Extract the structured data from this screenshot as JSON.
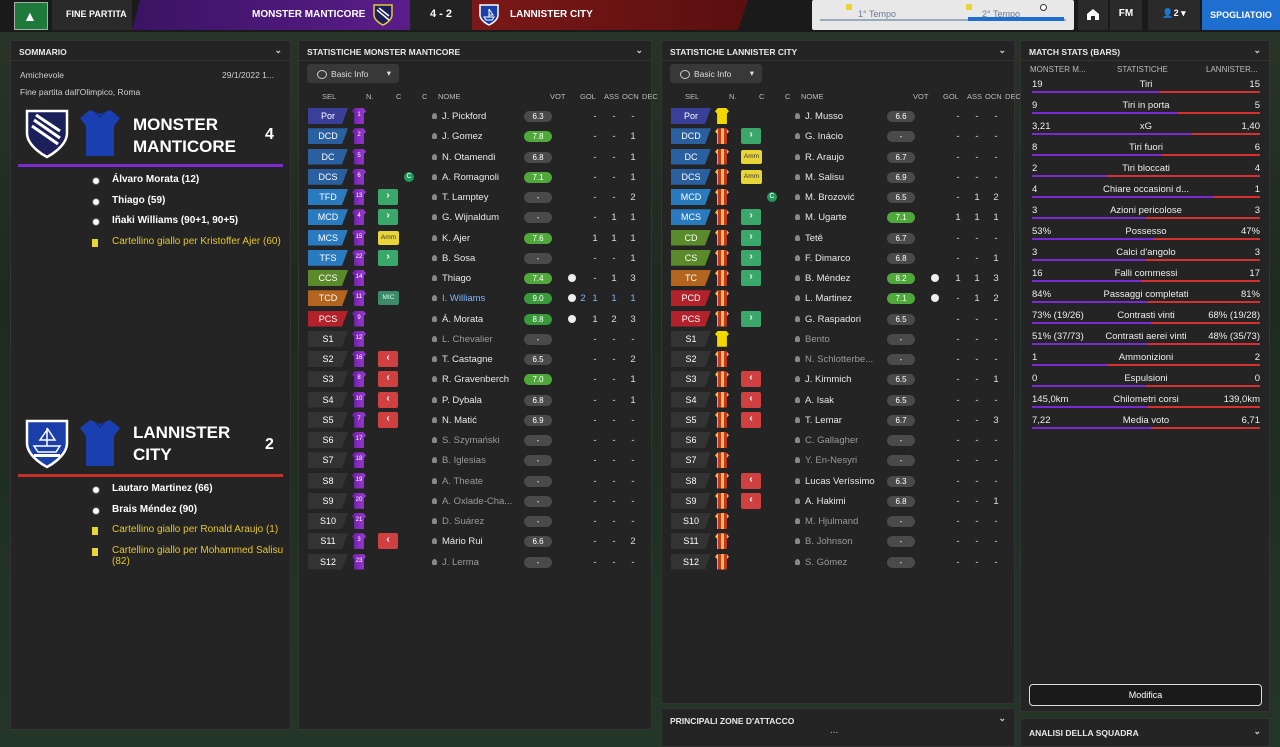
{
  "topbar": {
    "status": "FINE PARTITA",
    "home_team": "MONSTER MANTICORE",
    "score": "4 - 2",
    "away_team": "LANNISTER CITY",
    "first_half": "1° Tempo",
    "second_half": "2° Tempo",
    "fm": "FM",
    "squad_count": "2",
    "dressing_room": "SPOGLIATOIO"
  },
  "summary": {
    "title": "SOMMARIO",
    "competition": "Amichevole",
    "date": "29/1/2022 1...",
    "venue": "Fine partita dall'Olimpico, Roma",
    "home": {
      "name": "MONSTER MANTICORE",
      "score": "4",
      "events": [
        {
          "text": "Álvaro Morata (12)",
          "type": "goal"
        },
        {
          "text": "Thiago (59)",
          "type": "goal"
        },
        {
          "text": "Iñaki Williams (90+1, 90+5)",
          "type": "goal"
        },
        {
          "text": "Cartellino giallo per Kristoffer Ajer (60)",
          "type": "yellow"
        }
      ]
    },
    "away": {
      "name": "LANNISTER CITY",
      "score": "2",
      "events": [
        {
          "text": "Lautaro Martinez (66)",
          "type": "goal"
        },
        {
          "text": "Brais Méndez (90)",
          "type": "goal"
        },
        {
          "text": "Cartellino giallo per Ronald Araujo (1)",
          "type": "yellow"
        },
        {
          "text": "Cartellino giallo per Mohammed Salisu (82)",
          "type": "yellow"
        }
      ]
    }
  },
  "home_stats": {
    "title": "STATISTICHE MONSTER MANTICORE",
    "filter": "Basic Info",
    "columns": [
      "SEL",
      "N.",
      "C",
      "C",
      "NOME",
      "VOT",
      "GOL",
      "ASS",
      "OCN",
      "DEC"
    ],
    "rows": [
      {
        "pos": "Por",
        "num": "1",
        "c": "",
        "name": "J. Pickford",
        "rating": "6.3",
        "gol": "",
        "ass": "-",
        "ocn": "-",
        "dec": "-",
        "rc": "n",
        "pc": "#3a3f9a"
      },
      {
        "pos": "DCD",
        "num": "2",
        "c": "",
        "name": "J. Gomez",
        "rating": "7.8",
        "gol": "",
        "ass": "-",
        "ocn": "-",
        "dec": "1",
        "rc": "g",
        "pc": "#2a5fa0"
      },
      {
        "pos": "DC",
        "num": "5",
        "c": "",
        "name": "N. Otamendi",
        "rating": "6.8",
        "gol": "",
        "ass": "-",
        "ocn": "-",
        "dec": "1",
        "rc": "n",
        "pc": "#2a5fa0"
      },
      {
        "pos": "DCS",
        "num": "6",
        "c": "cap",
        "name": "A. Romagnoli",
        "rating": "7.1",
        "gol": "",
        "ass": "-",
        "ocn": "-",
        "dec": "1",
        "rc": "g",
        "pc": "#2a5fa0"
      },
      {
        "pos": "TFD",
        "num": "13",
        "c": "in",
        "name": "T. Lamptey",
        "rating": "-",
        "gol": "",
        "ass": "-",
        "ocn": "-",
        "dec": "2",
        "rc": "n",
        "pc": "#2a7ac0"
      },
      {
        "pos": "MCD",
        "num": "4",
        "c": "in",
        "name": "G. Wijnaldum",
        "rating": "-",
        "gol": "",
        "ass": "-",
        "ocn": "1",
        "dec": "1",
        "rc": "n",
        "pc": "#2a7ac0"
      },
      {
        "pos": "MCS",
        "num": "15",
        "c": "amm",
        "name": "K. Ajer",
        "rating": "7.6",
        "gol": "",
        "ass": "1",
        "ocn": "1",
        "dec": "1",
        "rc": "g",
        "pc": "#2a7ac0"
      },
      {
        "pos": "TFS",
        "num": "22",
        "c": "in",
        "name": "B. Sosa",
        "rating": "-",
        "gol": "",
        "ass": "-",
        "ocn": "-",
        "dec": "1",
        "rc": "n",
        "pc": "#2a7ac0"
      },
      {
        "pos": "CCS",
        "num": "14",
        "c": "",
        "name": "Thiago",
        "rating": "7.4",
        "gol": "ball",
        "ass": "-",
        "ocn": "1",
        "dec": "3",
        "rc": "g",
        "pc": "#5a8a2a"
      },
      {
        "pos": "TCD",
        "num": "11",
        "c": "mic",
        "name": "I. Williams",
        "rating": "9.0",
        "gol": "ball2",
        "ass": "1",
        "ocn": "1",
        "dec": "1",
        "rc": "e",
        "pc": "#b3641f"
      },
      {
        "pos": "PCS",
        "num": "9",
        "c": "",
        "name": "Á. Morata",
        "rating": "8.8",
        "gol": "ball",
        "ass": "1",
        "ocn": "2",
        "dec": "3",
        "rc": "e",
        "pc": "#b3222a"
      },
      {
        "pos": "S1",
        "num": "12",
        "c": "",
        "name": "L. Chevalier",
        "rating": "-",
        "gol": "",
        "ass": "-",
        "ocn": "-",
        "dec": "-",
        "rc": "n",
        "pc": "",
        "sub": true
      },
      {
        "pos": "S2",
        "num": "16",
        "c": "out",
        "name": "T. Castagne",
        "rating": "6.5",
        "gol": "",
        "ass": "-",
        "ocn": "-",
        "dec": "2",
        "rc": "n",
        "pc": "",
        "sub": true
      },
      {
        "pos": "S3",
        "num": "8",
        "c": "out",
        "name": "R. Gravenberch",
        "rating": "7.0",
        "gol": "",
        "ass": "-",
        "ocn": "-",
        "dec": "1",
        "rc": "g",
        "pc": "",
        "sub": true
      },
      {
        "pos": "S4",
        "num": "10",
        "c": "out",
        "name": "P. Dybala",
        "rating": "6.8",
        "gol": "",
        "ass": "-",
        "ocn": "-",
        "dec": "1",
        "rc": "n",
        "pc": "",
        "sub": true
      },
      {
        "pos": "S5",
        "num": "7",
        "c": "out",
        "name": "N. Matić",
        "rating": "6.9",
        "gol": "",
        "ass": "-",
        "ocn": "-",
        "dec": "-",
        "rc": "n",
        "pc": "",
        "sub": true
      },
      {
        "pos": "S6",
        "num": "17",
        "c": "",
        "name": "S. Szymański",
        "rating": "-",
        "gol": "",
        "ass": "-",
        "ocn": "-",
        "dec": "-",
        "rc": "n",
        "pc": "",
        "sub": true
      },
      {
        "pos": "S7",
        "num": "18",
        "c": "",
        "name": "B. Iglesias",
        "rating": "-",
        "gol": "",
        "ass": "-",
        "ocn": "-",
        "dec": "-",
        "rc": "n",
        "pc": "",
        "sub": true
      },
      {
        "pos": "S8",
        "num": "19",
        "c": "",
        "name": "A. Theate",
        "rating": "-",
        "gol": "",
        "ass": "-",
        "ocn": "-",
        "dec": "-",
        "rc": "n",
        "pc": "",
        "sub": true
      },
      {
        "pos": "S9",
        "num": "20",
        "c": "",
        "name": "A. Oxlade-Cha...",
        "rating": "-",
        "gol": "",
        "ass": "-",
        "ocn": "-",
        "dec": "-",
        "rc": "n",
        "pc": "",
        "sub": true
      },
      {
        "pos": "S10",
        "num": "21",
        "c": "",
        "name": "D. Suárez",
        "rating": "-",
        "gol": "",
        "ass": "-",
        "ocn": "-",
        "dec": "-",
        "rc": "n",
        "pc": "",
        "sub": true
      },
      {
        "pos": "S11",
        "num": "3",
        "c": "out",
        "name": "Mário Rui",
        "rating": "6.6",
        "gol": "",
        "ass": "-",
        "ocn": "-",
        "dec": "2",
        "rc": "n",
        "pc": "",
        "sub": true
      },
      {
        "pos": "S12",
        "num": "23",
        "c": "",
        "name": "J. Lerma",
        "rating": "-",
        "gol": "",
        "ass": "-",
        "ocn": "-",
        "dec": "-",
        "rc": "n",
        "pc": "",
        "sub": true
      }
    ]
  },
  "away_stats": {
    "title": "STATISTICHE LANNISTER CITY",
    "filter": "Basic Info",
    "columns": [
      "SEL",
      "N.",
      "C",
      "C",
      "NOME",
      "VOT",
      "GOL",
      "ASS",
      "OCN",
      "DEC"
    ],
    "rows": [
      {
        "pos": "Por",
        "c": "",
        "name": "J. Musso",
        "rating": "6.6",
        "gol": "",
        "ass": "-",
        "ocn": "-",
        "dec": "-",
        "rc": "n",
        "pc": "#3a3f9a",
        "gk": true
      },
      {
        "pos": "DCD",
        "c": "in",
        "name": "G. Inácio",
        "rating": "-",
        "gol": "",
        "ass": "-",
        "ocn": "-",
        "dec": "-",
        "rc": "n",
        "pc": "#2a5fa0"
      },
      {
        "pos": "DC",
        "c": "amm",
        "name": "R. Araujo",
        "rating": "6.7",
        "gol": "",
        "ass": "-",
        "ocn": "-",
        "dec": "-",
        "rc": "n",
        "pc": "#2a5fa0"
      },
      {
        "pos": "DCS",
        "c": "amm",
        "name": "M. Salisu",
        "rating": "6.9",
        "gol": "",
        "ass": "-",
        "ocn": "-",
        "dec": "-",
        "rc": "n",
        "pc": "#2a5fa0"
      },
      {
        "pos": "MCD",
        "c": "cap",
        "name": "M. Brozović",
        "rating": "6.5",
        "gol": "",
        "ass": "-",
        "ocn": "1",
        "dec": "2",
        "rc": "n",
        "pc": "#2a7ac0"
      },
      {
        "pos": "MCS",
        "c": "in",
        "name": "M. Ugarte",
        "rating": "7.1",
        "gol": "",
        "ass": "1",
        "ocn": "1",
        "dec": "1",
        "rc": "g",
        "pc": "#2a7ac0"
      },
      {
        "pos": "CD",
        "c": "in",
        "name": "Tetê",
        "rating": "6.7",
        "gol": "",
        "ass": "-",
        "ocn": "-",
        "dec": "-",
        "rc": "n",
        "pc": "#5a8a2a"
      },
      {
        "pos": "CS",
        "c": "in",
        "name": "F. Dimarco",
        "rating": "6.8",
        "gol": "",
        "ass": "-",
        "ocn": "-",
        "dec": "1",
        "rc": "n",
        "pc": "#5a8a2a"
      },
      {
        "pos": "TC",
        "c": "in",
        "name": "B. Méndez",
        "rating": "8.2",
        "gol": "ball",
        "ass": "1",
        "ocn": "1",
        "dec": "3",
        "rc": "g",
        "pc": "#b3641f"
      },
      {
        "pos": "PCD",
        "c": "",
        "name": "L. Martinez",
        "rating": "7.1",
        "gol": "ball",
        "ass": "-",
        "ocn": "1",
        "dec": "2",
        "rc": "g",
        "pc": "#b3222a"
      },
      {
        "pos": "PCS",
        "c": "in",
        "name": "G. Raspadori",
        "rating": "6.5",
        "gol": "",
        "ass": "-",
        "ocn": "-",
        "dec": "-",
        "rc": "n",
        "pc": "#b3222a"
      },
      {
        "pos": "S1",
        "c": "",
        "name": "Bento",
        "rating": "-",
        "gol": "",
        "ass": "-",
        "ocn": "-",
        "dec": "-",
        "rc": "n",
        "pc": "",
        "sub": true,
        "gk": true
      },
      {
        "pos": "S2",
        "c": "",
        "name": "N. Schlotterbe...",
        "rating": "-",
        "gol": "",
        "ass": "-",
        "ocn": "-",
        "dec": "-",
        "rc": "n",
        "pc": "",
        "sub": true
      },
      {
        "pos": "S3",
        "c": "out",
        "name": "J. Kimmich",
        "rating": "6.5",
        "gol": "",
        "ass": "-",
        "ocn": "-",
        "dec": "1",
        "rc": "n",
        "pc": "",
        "sub": true
      },
      {
        "pos": "S4",
        "c": "out",
        "name": "A. Isak",
        "rating": "6.5",
        "gol": "",
        "ass": "-",
        "ocn": "-",
        "dec": "-",
        "rc": "n",
        "pc": "",
        "sub": true
      },
      {
        "pos": "S5",
        "c": "out",
        "name": "T. Lemar",
        "rating": "6.7",
        "gol": "",
        "ass": "-",
        "ocn": "-",
        "dec": "3",
        "rc": "n",
        "pc": "",
        "sub": true
      },
      {
        "pos": "S6",
        "c": "",
        "name": "C. Gallagher",
        "rating": "-",
        "gol": "",
        "ass": "-",
        "ocn": "-",
        "dec": "-",
        "rc": "n",
        "pc": "",
        "sub": true
      },
      {
        "pos": "S7",
        "c": "",
        "name": "Y. En-Nesyri",
        "rating": "-",
        "gol": "",
        "ass": "-",
        "ocn": "-",
        "dec": "-",
        "rc": "n",
        "pc": "",
        "sub": true
      },
      {
        "pos": "S8",
        "c": "out",
        "name": "Lucas Veríssimo",
        "rating": "6.3",
        "gol": "",
        "ass": "-",
        "ocn": "-",
        "dec": "-",
        "rc": "n",
        "pc": "",
        "sub": true
      },
      {
        "pos": "S9",
        "c": "out",
        "name": "A. Hakimi",
        "rating": "6.8",
        "gol": "",
        "ass": "-",
        "ocn": "-",
        "dec": "1",
        "rc": "n",
        "pc": "",
        "sub": true
      },
      {
        "pos": "S10",
        "c": "",
        "name": "M. Hjulmand",
        "rating": "-",
        "gol": "",
        "ass": "-",
        "ocn": "-",
        "dec": "-",
        "rc": "n",
        "pc": "",
        "sub": true
      },
      {
        "pos": "S11",
        "c": "",
        "name": "B. Johnson",
        "rating": "-",
        "gol": "",
        "ass": "-",
        "ocn": "-",
        "dec": "-",
        "rc": "n",
        "pc": "",
        "sub": true
      },
      {
        "pos": "S12",
        "c": "",
        "name": "S. Gómez",
        "rating": "-",
        "gol": "",
        "ass": "-",
        "ocn": "-",
        "dec": "-",
        "rc": "n",
        "pc": "",
        "sub": true
      }
    ],
    "footer_title": "PRINCIPALI ZONE D'ATTACCO",
    "footer_more": "..."
  },
  "match_stats": {
    "title": "MATCH STATS (BARS)",
    "col_home": "MONSTER M...",
    "col_mid": "STATISTICHE",
    "col_away": "LANNISTER...",
    "rows": [
      {
        "home": "19",
        "label": "Tiri",
        "away": "15",
        "share": 0.56
      },
      {
        "home": "9",
        "label": "Tiri in porta",
        "away": "5",
        "share": 0.64
      },
      {
        "home": "3,21",
        "label": "xG",
        "away": "1,40",
        "share": 0.7
      },
      {
        "home": "8",
        "label": "Tiri fuori",
        "away": "6",
        "share": 0.57
      },
      {
        "home": "2",
        "label": "Tiri bloccati",
        "away": "4",
        "share": 0.33
      },
      {
        "home": "4",
        "label": "Chiare occasioni d...",
        "away": "1",
        "share": 0.8
      },
      {
        "home": "3",
        "label": "Azioni pericolose",
        "away": "3",
        "share": 0.5
      },
      {
        "home": "53%",
        "label": "Possesso",
        "away": "47%",
        "share": 0.53
      },
      {
        "home": "3",
        "label": "Calci d'angolo",
        "away": "3",
        "share": 0.5
      },
      {
        "home": "16",
        "label": "Falli commessi",
        "away": "17",
        "share": 0.48
      },
      {
        "home": "84%",
        "label": "Passaggi completati",
        "away": "81%",
        "share": 0.51
      },
      {
        "home": "73% (19/26)",
        "label": "Contrasti vinti",
        "away": "68% (19/28)",
        "share": 0.52
      },
      {
        "home": "51% (37/73)",
        "label": "Contrasti aerei vinti",
        "away": "48% (35/73)",
        "share": 0.51
      },
      {
        "home": "1",
        "label": "Ammonizioni",
        "away": "2",
        "share": 0.33
      },
      {
        "home": "0",
        "label": "Espulsioni",
        "away": "0",
        "share": 0.5
      },
      {
        "home": "145,0km",
        "label": "Chilometri corsi",
        "away": "139,0km",
        "share": 0.51
      },
      {
        "home": "7,22",
        "label": "Media voto",
        "away": "6,71",
        "share": 0.52
      }
    ],
    "button": "Modifica",
    "footer_title": "ANALISI DELLA SQUADRA"
  },
  "colors": {
    "home": "#7b2ad1",
    "away": "#d63030",
    "accent": "#1f6fd1"
  }
}
